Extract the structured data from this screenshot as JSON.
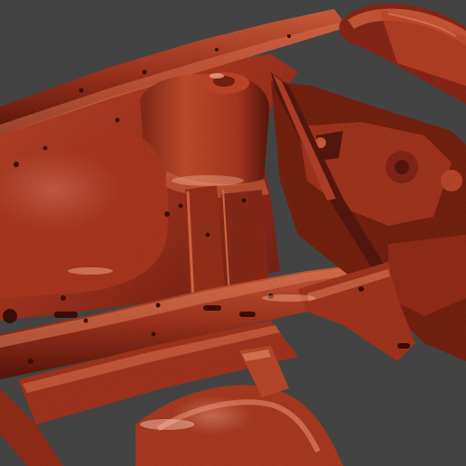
{
  "viewport": {
    "background_color": "#434343"
  },
  "model": {
    "kind": "3d-scan-mesh",
    "material_color": "#b53a22",
    "highlight_color": "#ff9a7a",
    "shadow_color": "#3e0f07"
  }
}
